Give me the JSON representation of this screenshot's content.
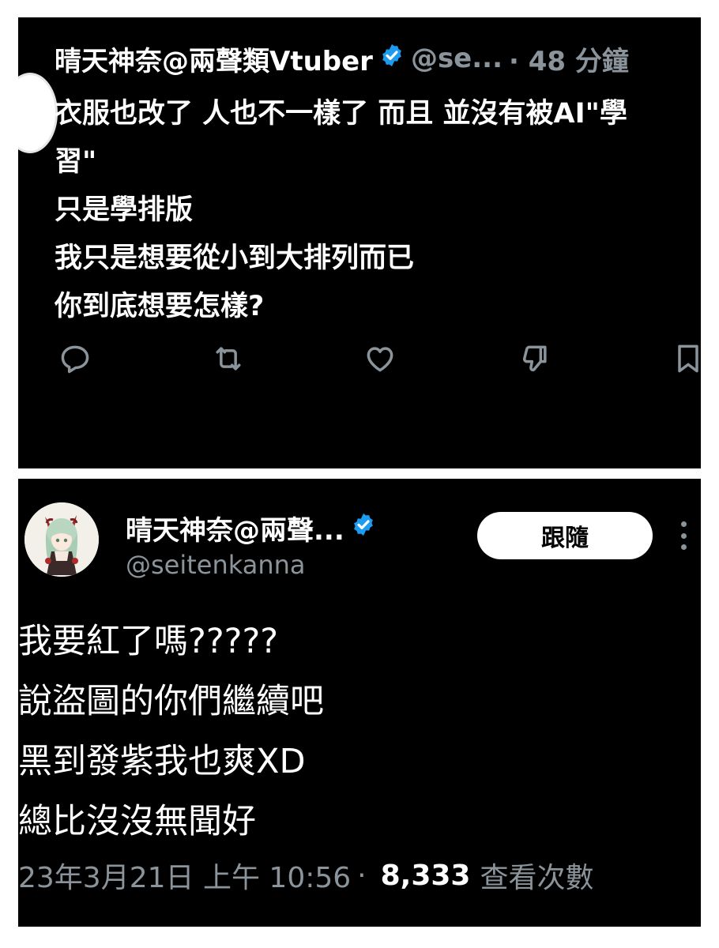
{
  "top_tweet": {
    "display_name": "晴天神奈@兩聲類Vtuber",
    "handle_truncated": "@se...",
    "time_ago": "· 48 分鐘",
    "lines": [
      "衣服也改了 人也不一樣了 而且 並沒有被AI\"學",
      "習\"",
      "只是學排版",
      "我只是想要從小到大排列而已",
      "你到底想要怎樣?"
    ],
    "actions": [
      "reply-icon",
      "retweet-icon",
      "like-icon",
      "dislike-icon",
      "bookmark-icon"
    ]
  },
  "bottom_tweet": {
    "display_name": "晴天神奈@兩聲...",
    "handle": "@seitenkanna",
    "follow_label": "跟隨",
    "lines": [
      "我要紅了嗎?????",
      "說盜圖的你們繼續吧",
      "黑到發紫我也爽XD",
      "總比沒沒無聞好"
    ],
    "timestamp": "23年3月21日 上午 10:56",
    "separator": "·",
    "views_count": "8,333",
    "views_label": "查看次數"
  },
  "colors": {
    "background": "#000000",
    "text": "#ffffff",
    "muted": "#8b949b",
    "verified": "#1d9bf0"
  }
}
